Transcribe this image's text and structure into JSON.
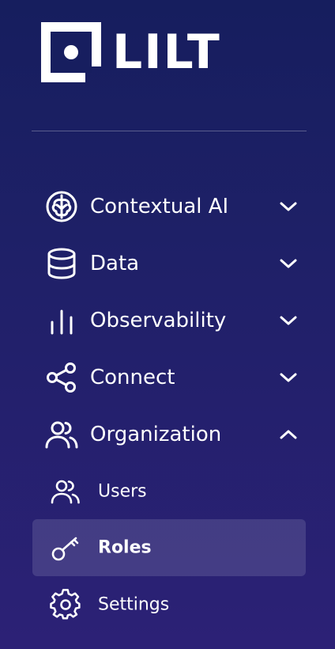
{
  "brand": {
    "name": "LILT",
    "logo_icon": "lilt-logo-mark",
    "text_color": "#ffffff"
  },
  "theme": {
    "background_top": "#161e5e",
    "background_bottom": "#2c2176",
    "active_item_bg": "rgba(255,255,255,0.13)"
  },
  "nav": {
    "items": [
      {
        "label": "Contextual AI",
        "icon": "brain-icon",
        "expanded": false
      },
      {
        "label": "Data",
        "icon": "database-icon",
        "expanded": false
      },
      {
        "label": "Observability",
        "icon": "bar-chart-icon",
        "expanded": false
      },
      {
        "label": "Connect",
        "icon": "share-icon",
        "expanded": false
      },
      {
        "label": "Organization",
        "icon": "users-icon",
        "expanded": true
      }
    ],
    "organization_children": [
      {
        "label": "Users",
        "icon": "users-icon",
        "active": false
      },
      {
        "label": "Roles",
        "icon": "key-icon",
        "active": true
      },
      {
        "label": "Settings",
        "icon": "gear-icon",
        "active": false
      }
    ]
  }
}
